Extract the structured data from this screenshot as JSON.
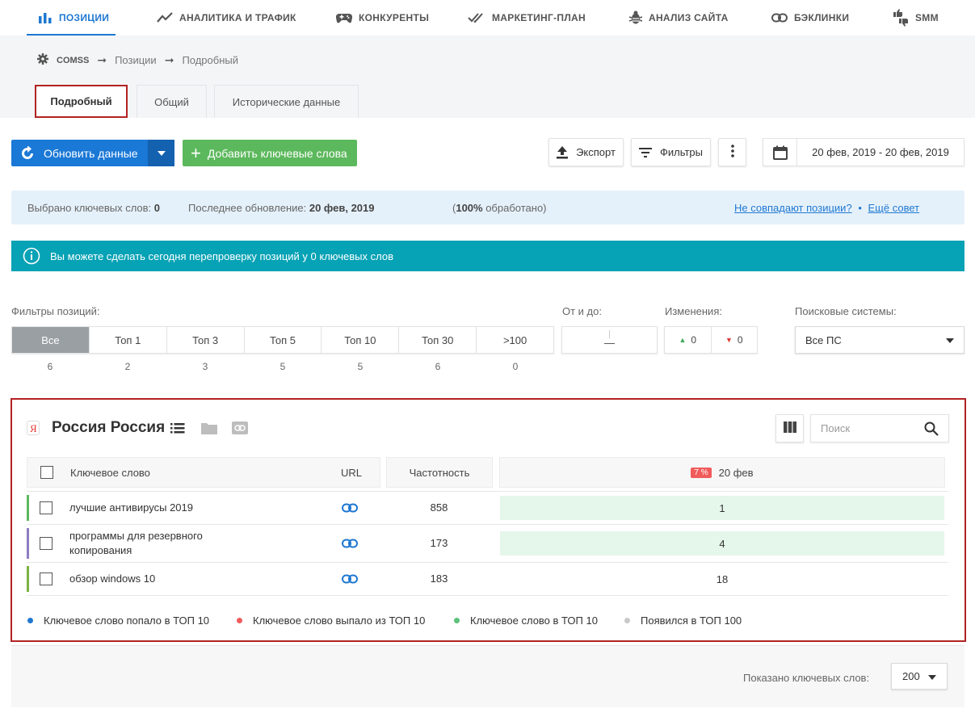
{
  "nav": {
    "items": [
      {
        "label": "ПОЗИЦИИ",
        "icon": "bar-chart-icon"
      },
      {
        "label": "АНАЛИТИКА И ТРАФИК",
        "icon": "trend-line-icon"
      },
      {
        "label": "КОНКУРЕНТЫ",
        "icon": "gamepad-icon"
      },
      {
        "label": "МАРКЕТИНГ-ПЛАН",
        "icon": "double-check-icon"
      },
      {
        "label": "АНАЛИЗ САЙТА",
        "icon": "bug-icon"
      },
      {
        "label": "БЭКЛИНКИ",
        "icon": "link-icon"
      },
      {
        "label": "SMM",
        "icon": "thumbs-icon"
      }
    ]
  },
  "breadcrumb": {
    "root": "COMSS",
    "level1": "Позиции",
    "level2": "Подробный"
  },
  "tabs": [
    {
      "label": "Подробный",
      "active": true
    },
    {
      "label": "Общий"
    },
    {
      "label": "Исторические данные"
    }
  ],
  "toolbar": {
    "update_label": "Обновить данные",
    "add_label": "Добавить ключевые слова",
    "export_label": "Экспорт",
    "filters_label": "Фильтры",
    "date_range": "20 фев, 2019 - 20 фев, 2019"
  },
  "info": {
    "selected_label": "Выбрано ключевых слов:",
    "selected_value": "0",
    "last_update_label": "Последнее обновление:",
    "last_update_value": "20 фев, 2019",
    "processed_prefix": "(",
    "processed_value": "100%",
    "processed_suffix": " обработано)",
    "mismatch_link": "Не совпадают позиции?",
    "separator": "•",
    "tip_link": "Ещё совет"
  },
  "notice": {
    "text": "Вы можете сделать сегодня перепроверку позиций у 0 ключевых слов"
  },
  "filters": {
    "positions_label": "Фильтры позиций:",
    "segments": [
      {
        "label": "Все",
        "count": "6",
        "active": true
      },
      {
        "label": "Топ 1",
        "count": "2"
      },
      {
        "label": "Топ 3",
        "count": "3"
      },
      {
        "label": "Топ 5",
        "count": "5"
      },
      {
        "label": "Топ 10",
        "count": "5"
      },
      {
        "label": "Топ 30",
        "count": "6"
      },
      {
        "label": ">100",
        "count": "0"
      }
    ],
    "range_label": "От и до:",
    "range_value": "—",
    "changes_label": "Изменения:",
    "up_value": "0",
    "down_value": "0",
    "engines_label": "Поисковые системы:",
    "engine_selected": "Все ПС"
  },
  "panel": {
    "title": "Россия Россия",
    "search_placeholder": "Поиск",
    "columns": {
      "keyword": "Ключевое слово",
      "url": "URL",
      "frequency": "Частотность",
      "date": "20 фев",
      "date_badge": "7 %"
    },
    "rows": [
      {
        "keyword": "лучшие антивирусы 2019",
        "frequency": "858",
        "position": "1",
        "marker_color": "#5cb85c"
      },
      {
        "keyword": "программы для резервного копирования",
        "frequency": "173",
        "position": "4",
        "marker_color": "#8e7cc3"
      },
      {
        "keyword": "обзор windows 10",
        "frequency": "183",
        "position": "18",
        "marker_color": "#7cb342"
      }
    ],
    "legend": [
      {
        "label": "Ключевое слово попало в ТОП 10",
        "color": "#1f78d1"
      },
      {
        "label": "Ключевое слово выпало из ТОП 10",
        "color": "#f05b5b"
      },
      {
        "label": "Ключевое слово в ТОП 10",
        "color": "#5cc17a"
      },
      {
        "label": "Появился в ТОП 100",
        "color": "#c8c8c8"
      }
    ]
  },
  "footer": {
    "shown_label": "Показано ключевых слов:",
    "shown_value": "200"
  },
  "colors": {
    "accent": "#1f78d1",
    "green": "#5cb85c",
    "teal": "#06a2b5",
    "highlight_border": "#b22222"
  }
}
